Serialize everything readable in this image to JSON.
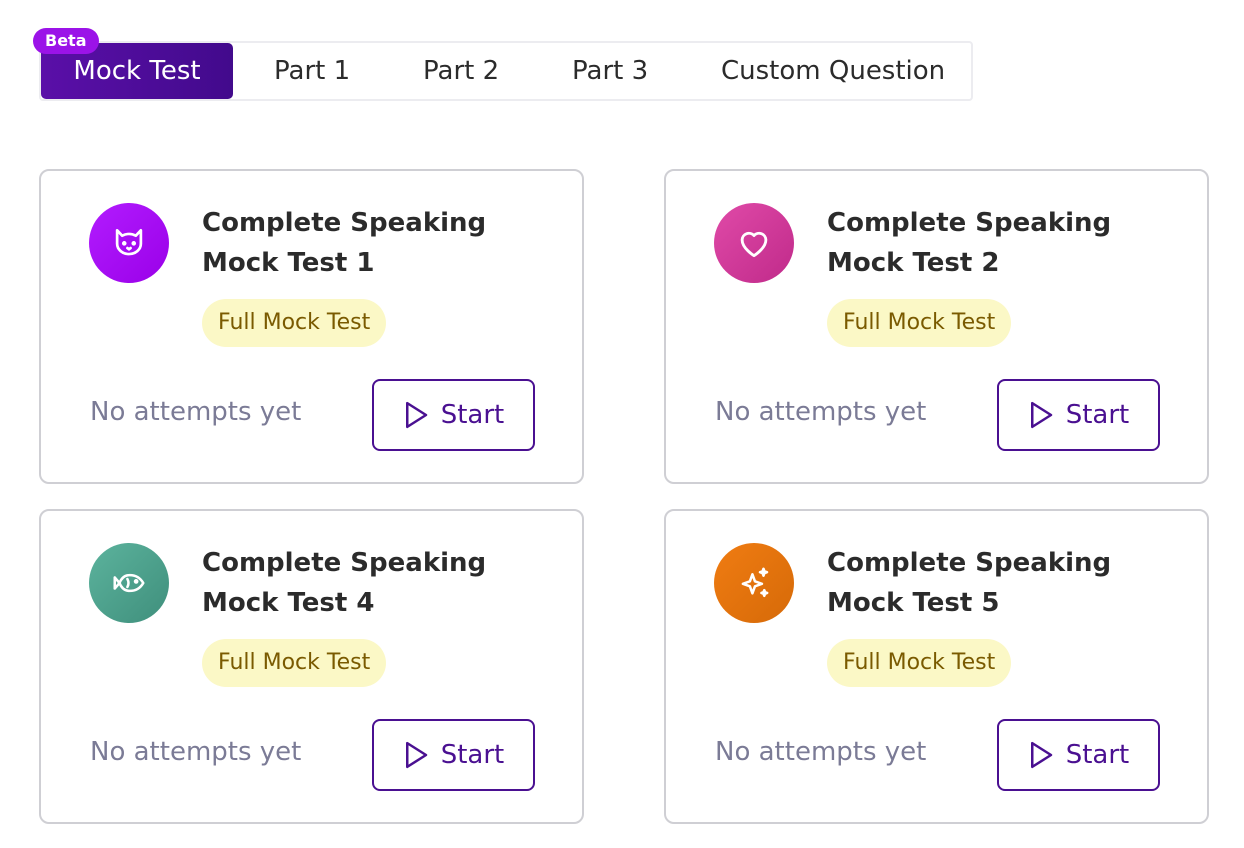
{
  "tabs": {
    "beta_badge": "Beta",
    "items": [
      {
        "label": "Mock Test",
        "active": true
      },
      {
        "label": "Part 1",
        "active": false
      },
      {
        "label": "Part 2",
        "active": false
      },
      {
        "label": "Part 3",
        "active": false
      },
      {
        "label": "Custom Question",
        "active": false
      }
    ]
  },
  "cards": [
    {
      "title": "Complete Speaking Mock Test 1",
      "tag": "Full Mock Test",
      "attempts": "No attempts yet",
      "button": "Start",
      "icon": "cat-icon",
      "color": "#a010f0"
    },
    {
      "title": "Complete Speaking Mock Test 2",
      "tag": "Full Mock Test",
      "attempts": "No attempts yet",
      "button": "Start",
      "icon": "heart-icon",
      "color": "#d03a9a"
    },
    {
      "title": "Complete Speaking Mock Test 4",
      "tag": "Full Mock Test",
      "attempts": "No attempts yet",
      "button": "Start",
      "icon": "fish-icon",
      "color": "#4fa08c"
    },
    {
      "title": "Complete Speaking Mock Test 5",
      "tag": "Full Mock Test",
      "attempts": "No attempts yet",
      "button": "Start",
      "icon": "sparkles-icon",
      "color": "#e07010"
    }
  ]
}
